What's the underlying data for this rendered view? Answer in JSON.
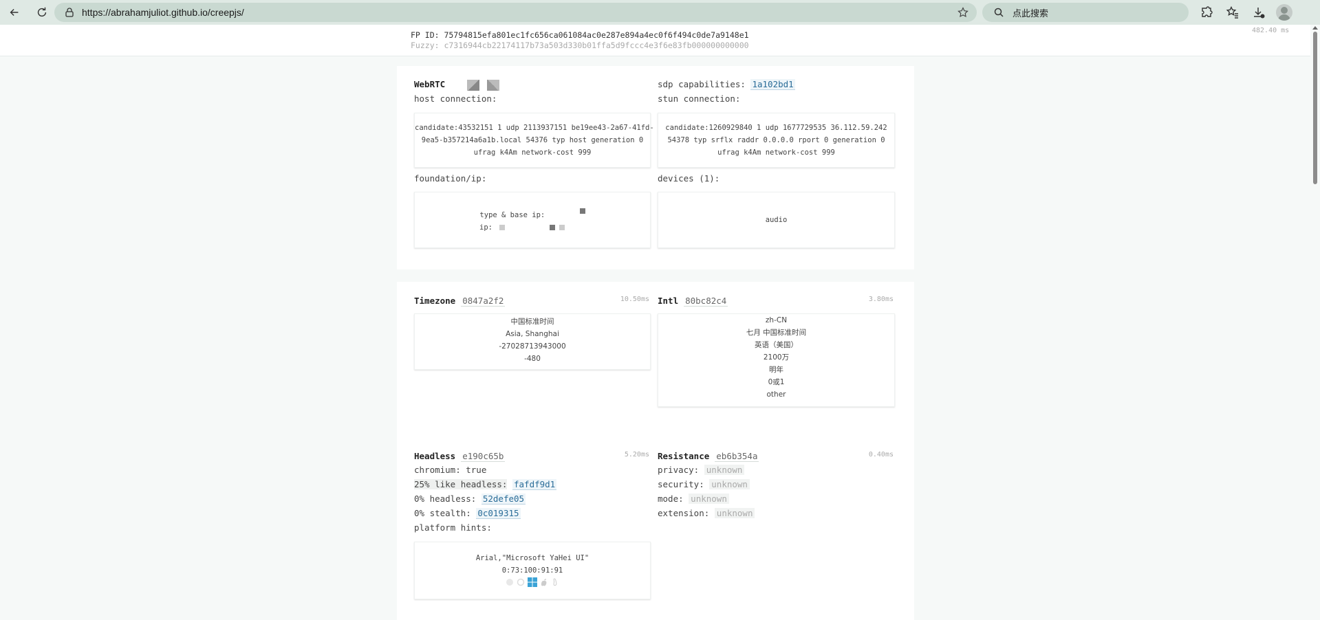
{
  "browser": {
    "url": "https://abrahamjuliot.github.io/creepjs/",
    "search_placeholder": "点此搜索"
  },
  "header": {
    "fp_id": "FP ID: 75794815efa801ec1fc656ca061084ac0e287e894a4ec0f6f494c0de7a9148e1",
    "fuzzy": "Fuzzy: c7316944cb22174117b73a503d330b01ffa5d9fccc4e3f6e83fb000000000000",
    "time": "482.40 ms"
  },
  "webrtc": {
    "title": "WebRTC",
    "sdp_label": "sdp capabilities:",
    "sdp_hash": "1a102bd1",
    "host_label": "host connection:",
    "host_candidate": [
      "candidate:43532151 1 udp 2113937151 be19ee43-2a67-41fd-",
      "9ea5-b357214a6a1b.local 54376 typ host generation 0",
      "ufrag k4Am network-cost 999"
    ],
    "stun_label": "stun connection:",
    "stun_candidate": [
      "candidate:1260929840 1 udp 1677729535 36.112.59.242",
      "54378 typ srflx raddr 0.0.0.0 rport 0 generation 0",
      "ufrag k4Am network-cost 999"
    ],
    "foundation_label": "foundation/ip:",
    "type_base_ip": "type & base ip:",
    "ip": "ip:",
    "devices_label": "devices (1):",
    "devices": "audio"
  },
  "timezone": {
    "title": "Timezone",
    "hash": "0847a2f2",
    "time": "10.50ms",
    "lines": [
      "中国标准时间",
      "Asia, Shanghai",
      "-27028713943000",
      "-480"
    ]
  },
  "intl": {
    "title": "Intl",
    "hash": "80bc82c4",
    "time": "3.80ms",
    "lines": [
      "zh-CN",
      "七月 中国标准时间",
      "英语（美国）",
      "2100万",
      "明年",
      "0或1",
      "other"
    ]
  },
  "headless": {
    "title": "Headless",
    "hash": "e190c65b",
    "time": "5.20ms",
    "chromium": "chromium: true",
    "like_label": "25% like headless:",
    "like_hash": "fafdf9d1",
    "headless_label": "0% headless:",
    "headless_hash": "52defe05",
    "stealth_label": "0% stealth:",
    "stealth_hash": "0c019315",
    "platform_label": "platform hints:",
    "fonts": "Arial,\"Microsoft YaHei UI\"",
    "ratio": "0:73:100:91:91"
  },
  "resistance": {
    "title": "Resistance",
    "hash": "eb6b354a",
    "time": "0.40ms",
    "privacy_label": "privacy:",
    "security_label": "security:",
    "mode_label": "mode:",
    "extension_label": "extension:",
    "unknown": "unknown"
  },
  "colors": {
    "link": "#2a6c98",
    "accent_icon": "#3ba3d6",
    "chrome_bg": "#dfe9e4"
  }
}
